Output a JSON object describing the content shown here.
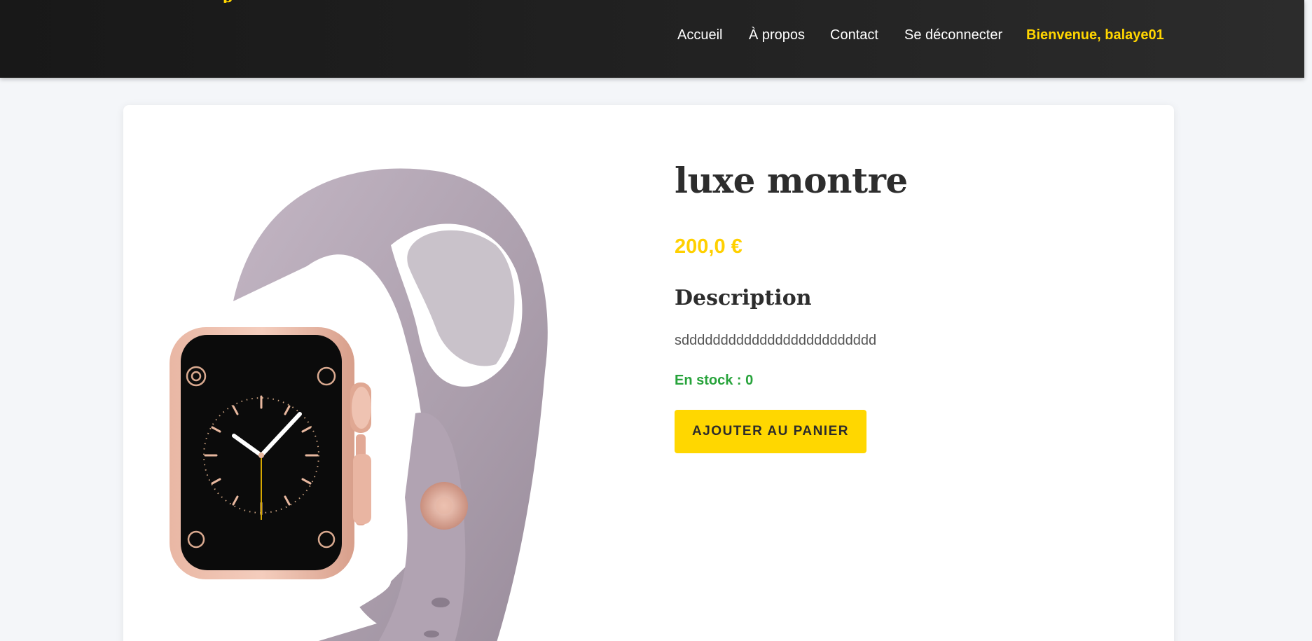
{
  "nav": {
    "items": [
      {
        "label": "Accueil"
      },
      {
        "label": "À propos"
      },
      {
        "label": "Contact"
      },
      {
        "label": "Se déconnecter"
      }
    ],
    "welcome": "Bienvenue, balaye01"
  },
  "product": {
    "title": "luxe montre",
    "price": "200,0 €",
    "description_heading": "Description",
    "description": "sddddddddddddddddddddddddd",
    "stock": "En stock : 0",
    "add_to_cart": "AJOUTER AU PANIER",
    "image": "smartwatch-image"
  },
  "colors": {
    "header_bg": "#1f1f1f",
    "accent": "#ffd500",
    "stock_green": "#27a33b",
    "page_bg": "#f4f6f9"
  }
}
